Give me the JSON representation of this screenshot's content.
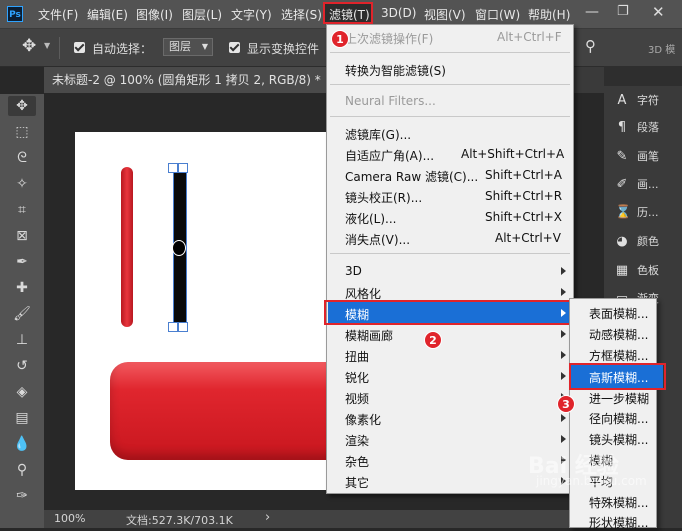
{
  "app": {
    "logo": "Ps"
  },
  "menubar": {
    "items": [
      "文件(F)",
      "编辑(E)",
      "图像(I)",
      "图层(L)",
      "文字(Y)",
      "选择(S)",
      "滤镜(T)",
      "3D(D)",
      "视图(V)",
      "窗口(W)",
      "帮助(H)"
    ],
    "active_index": 6
  },
  "options_bar": {
    "auto_select_label": "自动选择：",
    "layer_select_value": "图层",
    "show_transform_label": "显示变换控件",
    "right_label": "3D 模"
  },
  "document": {
    "tab_title": "未标题-2 @ 100% (圆角矩形 1 拷贝 2, RGB/8) *",
    "close_glyph": "×"
  },
  "status_bar": {
    "zoom": "100%",
    "doc_info": "文档:527.3K/703.1K",
    "arrow": "›"
  },
  "right_panel": {
    "items": [
      {
        "icon": "character-icon",
        "glyph": "A",
        "label": "字符"
      },
      {
        "icon": "paragraph-icon",
        "glyph": "¶",
        "label": "段落"
      },
      {
        "icon": "brush-settings-icon",
        "glyph": "✎",
        "label": "画笔"
      },
      {
        "icon": "brush-icon",
        "glyph": "✐",
        "label": "画..."
      },
      {
        "icon": "history-icon",
        "glyph": "⌛",
        "label": "历..."
      },
      {
        "icon": "color-icon",
        "glyph": "◕",
        "label": "颜色"
      },
      {
        "icon": "swatches-icon",
        "glyph": "▦",
        "label": "色板"
      },
      {
        "icon": "gradient-icon",
        "glyph": "▭",
        "label": "渐变"
      }
    ]
  },
  "filter_menu": {
    "last_filter": {
      "label": "上次滤镜操作(F)",
      "shortcut": "Alt+Ctrl+F"
    },
    "smart_filter": "转换为智能滤镜(S)",
    "neural": "Neural Filters...",
    "group2": [
      {
        "label": "滤镜库(G)...",
        "shortcut": ""
      },
      {
        "label": "自适应广角(A)...",
        "shortcut": "Alt+Shift+Ctrl+A"
      },
      {
        "label": "Camera Raw 滤镜(C)...",
        "shortcut": "Shift+Ctrl+A"
      },
      {
        "label": "镜头校正(R)...",
        "shortcut": "Shift+Ctrl+R"
      },
      {
        "label": "液化(L)...",
        "shortcut": "Shift+Ctrl+X"
      },
      {
        "label": "消失点(V)...",
        "shortcut": "Alt+Ctrl+V"
      }
    ],
    "group3": [
      "3D",
      "风格化",
      "模糊",
      "模糊画廊",
      "扭曲",
      "锐化",
      "视频",
      "像素化",
      "渲染",
      "杂色",
      "其它"
    ],
    "highlight_index": 2
  },
  "blur_submenu": {
    "items": [
      "表面模糊...",
      "动感模糊...",
      "方框模糊...",
      "高斯模糊...",
      "进一步模糊",
      "径向模糊...",
      "镜头模糊...",
      "模糊",
      "平均",
      "特殊模糊...",
      "形状模糊..."
    ],
    "highlight_index": 3
  },
  "steps": [
    "1",
    "2",
    "3"
  ],
  "watermark": {
    "text": "Bai 经验",
    "sub": "jingyan.baidu.com"
  },
  "colors": {
    "menu_highlight": "#1a6fd6",
    "callout_red": "#e0242b",
    "shape_red": "#d92a32"
  }
}
